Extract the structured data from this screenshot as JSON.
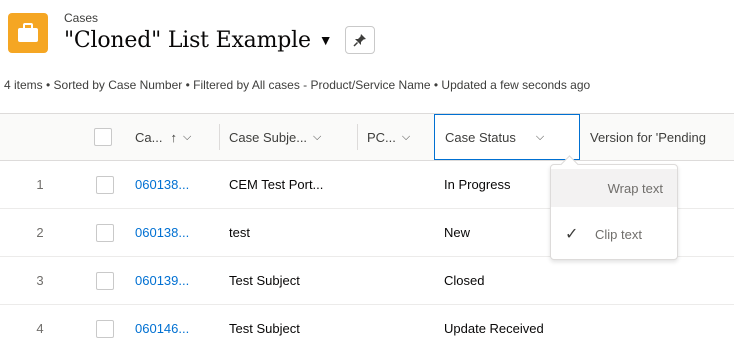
{
  "header": {
    "object_label": "Cases",
    "list_title": "\"Cloned\" List Example",
    "caret": "▼"
  },
  "meta": "4 items • Sorted by Case Number • Filtered by All cases - Product/Service Name • Updated a few seconds ago",
  "table": {
    "columns": [
      {
        "label": "Ca...",
        "sort": "↑"
      },
      {
        "label": "Case Subje..."
      },
      {
        "label": "PC..."
      },
      {
        "label": "Case Status"
      },
      {
        "label": "Version for 'Pending"
      }
    ],
    "rows": [
      {
        "n": "1",
        "case_number": "060138...",
        "subject": "CEM Test Port...",
        "status": "In Progress"
      },
      {
        "n": "2",
        "case_number": "060138...",
        "subject": "test",
        "status": "New"
      },
      {
        "n": "3",
        "case_number": "060139...",
        "subject": "Test Subject",
        "status": "Closed"
      },
      {
        "n": "4",
        "case_number": "060146...",
        "subject": "Test Subject",
        "status": "Update Received"
      }
    ]
  },
  "menu": {
    "wrap": "Wrap text",
    "clip": "Clip text",
    "check": "✓"
  }
}
